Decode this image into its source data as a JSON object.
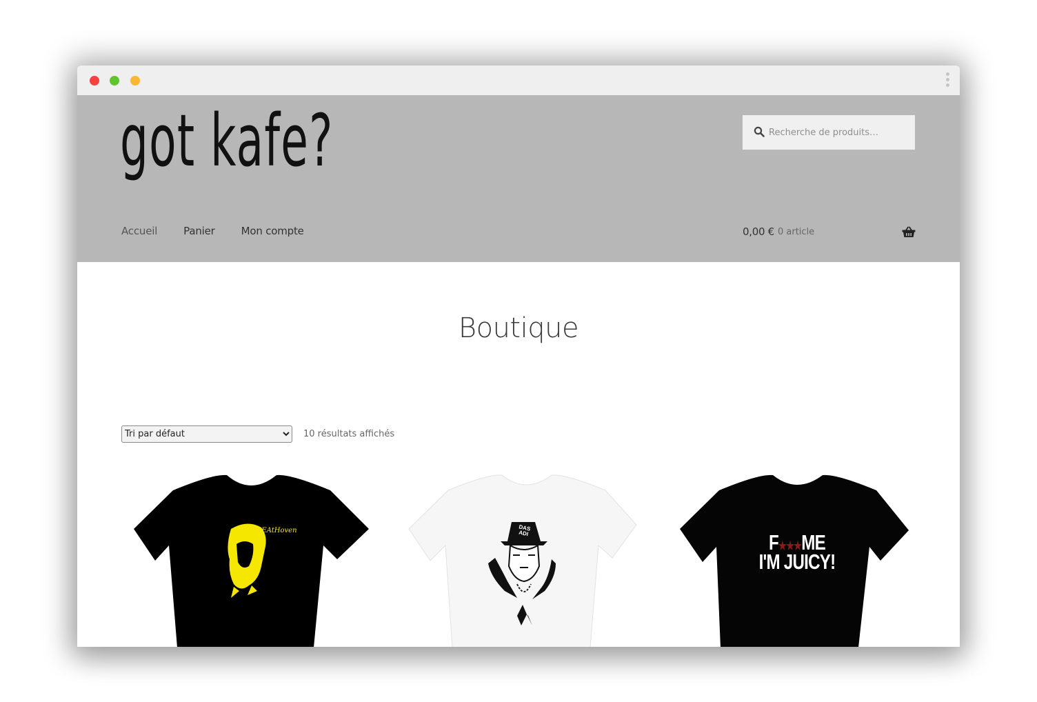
{
  "site": {
    "logo": "got kafe?",
    "search_placeholder": "Recherche de produits…"
  },
  "nav": {
    "items": [
      {
        "label": "Accueil"
      },
      {
        "label": "Panier"
      },
      {
        "label": "Mon compte"
      }
    ]
  },
  "cart": {
    "total": "0,00 €",
    "count": "0 article"
  },
  "main": {
    "title": "Boutique",
    "orderby_selected": "Tri par défaut",
    "result_count": "10 résultats affichés"
  },
  "products": [
    {
      "print_text": "bEAtHoven",
      "shirt_color": "#000000",
      "ink_color": "#f5e700"
    },
    {
      "print_text": "DAS ADI",
      "shirt_color": "#f6f6f6",
      "ink_color": "#111111"
    },
    {
      "print_text_line1": "F",
      "stars": "★★★",
      "print_text_line1_end": "ME",
      "print_text_line2": "I'M JUICY!",
      "shirt_color": "#050505",
      "ink_color": "#ffffff",
      "star_color": "#8b1a1a"
    }
  ],
  "colors": {
    "header_bg": "#b7b7b7",
    "titlebar_bg": "#efefef",
    "dot_red": "#f8413e",
    "dot_green": "#5fc42d",
    "dot_yellow": "#fbb733"
  },
  "icons": {
    "search": "magnifier-icon",
    "cart": "basket-icon",
    "menu": "kebab-menu-icon"
  }
}
